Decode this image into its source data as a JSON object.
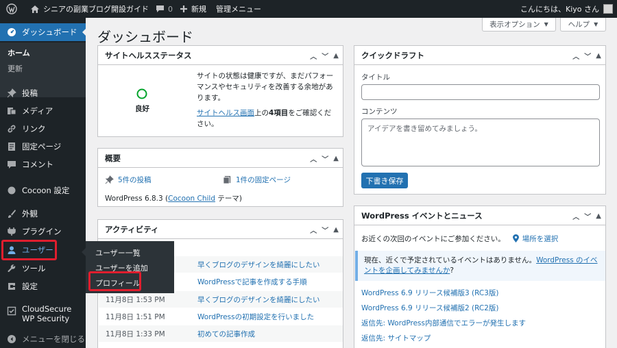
{
  "adminbar": {
    "site_name": "シニアの副業ブログ開設ガイド",
    "comments_count": "0",
    "new_label": "新規",
    "admin_menu": "管理メニュー",
    "greeting": "こんにちは、Kiyo さん"
  },
  "sidebar": {
    "dashboard": "ダッシュボード",
    "home": "ホーム",
    "updates": "更新",
    "items": [
      {
        "label": "投稿",
        "icon": "pin-icon"
      },
      {
        "label": "メディア",
        "icon": "media-icon"
      },
      {
        "label": "リンク",
        "icon": "link-icon"
      },
      {
        "label": "固定ページ",
        "icon": "page-icon"
      },
      {
        "label": "コメント",
        "icon": "comment-icon"
      },
      {
        "label": "Cocoon 設定",
        "icon": "circle-icon"
      },
      {
        "label": "外観",
        "icon": "brush-icon"
      },
      {
        "label": "プラグイン",
        "icon": "plugin-icon"
      },
      {
        "label": "ユーザー",
        "icon": "user-icon"
      },
      {
        "label": "ツール",
        "icon": "wrench-icon"
      },
      {
        "label": "設定",
        "icon": "settings-icon"
      },
      {
        "label": "CloudSecure WP Security",
        "icon": "shield-icon"
      }
    ],
    "collapse": "メニューを閉じる"
  },
  "flyout": {
    "items": [
      "ユーザー一覧",
      "ユーザーを追加",
      "プロフィール"
    ]
  },
  "page": {
    "title": "ダッシュボード",
    "screen_options": "表示オプション",
    "help": "ヘルプ"
  },
  "site_health": {
    "title": "サイトヘルスステータス",
    "status": "良好",
    "desc": "サイトの状態は健康ですが、まだパフォーマンスやセキュリティを改善する余地があります。",
    "link": "サイトヘルス画面",
    "rest1": "上の",
    "count": "4項目",
    "rest2": "をご確認ください。"
  },
  "overview": {
    "title": "概要",
    "posts": "5件の投稿",
    "pages": "1件の固定ページ",
    "version_prefix": "WordPress 6.8.3 (",
    "theme_link": "Cocoon Child",
    "version_suffix": " テーマ)"
  },
  "activity": {
    "title": "アクティビティ",
    "rows": [
      {
        "date": "",
        "title": "早くブログのデザインを綺麗にしたい"
      },
      {
        "date": "",
        "title": "WordPressで記事を作成する手順"
      },
      {
        "date": "11月8日 1:53 PM",
        "title": "早くブログのデザインを綺麗にしたい"
      },
      {
        "date": "11月8日 1:51 PM",
        "title": "WordPressの初期設定を行いました"
      },
      {
        "date": "11月8日 1:33 PM",
        "title": "初めての記事作成"
      }
    ]
  },
  "quick_draft": {
    "title": "クイックドラフト",
    "title_label": "タイトル",
    "content_label": "コンテンツ",
    "content_placeholder": "アイデアを書き留めてみましょう。",
    "save": "下書き保存"
  },
  "events": {
    "title": "WordPress イベントとニュース",
    "intro": "お近くの次回のイベントにご参加ください。",
    "location": "場所を選択",
    "notice_text": "現在、近くで予定されているイベントはありません。",
    "notice_link": "WordPress のイベントを企画してみませんか",
    "notice_q": "?",
    "news": [
      "WordPress 6.9 リリース候補版3 (RC3版)",
      "WordPress 6.9 リリース候補版2 (RC2版)",
      "返信先: WordPress内部通信でエラーが発生します",
      "返信先: サイトマップ"
    ]
  },
  "colors": {
    "admin_bg": "#1d2327",
    "accent": "#2271b1",
    "highlight_red": "#e01e2e"
  }
}
